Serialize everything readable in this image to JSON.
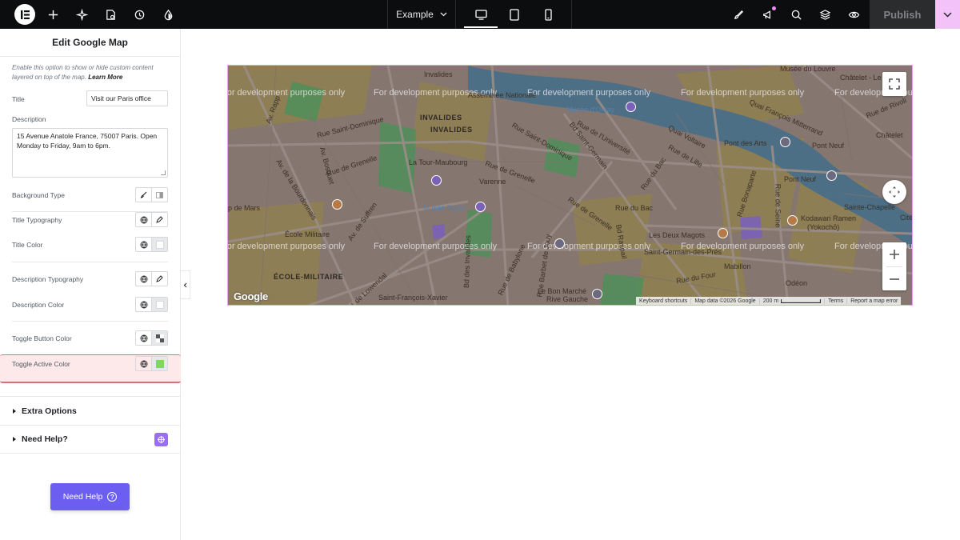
{
  "topbar": {
    "document_name": "Example",
    "publish_label": "Publish"
  },
  "panel": {
    "title": "Edit Google Map",
    "note_text": "Enable this option to show or hide custom content layered on top of the map.",
    "note_link": "Learn More",
    "fields": {
      "title_label": "Title",
      "title_value": "Visit our Paris office",
      "description_label": "Description",
      "description_value": "15 Avenue Anatole France, 75007 Paris. Open Monday to Friday, 9am to 6pm.",
      "background_type_label": "Background Type",
      "title_typography_label": "Title Typography",
      "title_color_label": "Title Color",
      "description_typography_label": "Description Typography",
      "description_color_label": "Description Color",
      "toggle_button_color_label": "Toggle Button Color",
      "toggle_active_color_label": "Toggle Active Color"
    },
    "colors": {
      "toggle_active": "#7ed957",
      "highlight_border": "#e06b7b"
    },
    "sections": {
      "extra_options": "Extra Options",
      "need_help": "Need Help?"
    },
    "help_button": "Need Help"
  },
  "map": {
    "watermark": "For development purposes only",
    "labels": {
      "invalides_1": "INVALIDES",
      "invalides_2": "INVALIDES",
      "invalides_small": "Invalides",
      "ecole_militaire_caps": "ÉCOLE-MILITAIRE",
      "musee_louvre": "Musée du Louvre",
      "chatelet": "Châtelet - Le",
      "chatelet2": "Châtelet",
      "musee_orsay": "Musée d'Orsay",
      "assemblee": "Assemblée Nationale",
      "quai_mitterrand": "Quai François Mitterrand",
      "rue_rivoli": "Rue de Rivoli",
      "pont_arts": "Pont des Arts",
      "pont_neuf_1": "Pont Neuf",
      "pont_neuf_2": "Pont Neuf",
      "quai_voltaire": "Quai Voltaire",
      "rue_universite": "Rue de l'Université",
      "rue_lille": "Rue de Lille",
      "rue_bac": "Rue du Bac",
      "rue_bac_metro": "Rue du Bac",
      "rue_st_dominique": "Rue Saint-Dominique",
      "rue_st_dominique_2": "Rue Saint-Dominique",
      "rue_grenelle_1": "Rue de Grenelle",
      "rue_grenelle_2": "Rue de Grenelle",
      "rue_grenelle_3": "Rue de Grenelle",
      "bd_st_germain": "Bd Saint-Germain",
      "la_tour_maubourg": "La Tour-Maubourg",
      "varenne": "Varenne",
      "musee_rodin": "Musée Rodin",
      "ecole_militaire": "École Militaire",
      "av_rapp": "Av. Rapp",
      "av_bosquet": "Av. Bosquet",
      "av_bourdonnais": "Av. de la Bourdonnais",
      "champ_mars": "p de Mars",
      "les_deux_magots": "Les Deux Magots",
      "st_germain_pres": "Saint-Germain-des-Prés",
      "mabillon": "Mabillon",
      "odeon": "Odéon",
      "rue_four": "Rue du Four",
      "le_bon_marche": "Le Bon Marché",
      "rive_gauche": "Rive Gauche",
      "st_francois_xavier": "Saint-François-Xavier",
      "rue_bonaparte": "Rue Bonaparte",
      "rue_seine": "Rue de Seine",
      "kodawari": "Kodawari Ramen",
      "yokocho": "(Yokochō)",
      "sainte_chapelle": "Sainte-Chapelle",
      "cite": "Cité",
      "bd_raspail": "Bd Raspail",
      "rue_babylone": "Rue de Babylone",
      "bd_invalides": "Bd des Invalides",
      "rue_barbet": "Rue Barbet de Jouy",
      "av_lowendal": "Av. de Lowendal",
      "av_suffren": "Av. de Suffren"
    },
    "attribution": {
      "shortcuts": "Keyboard shortcuts",
      "map_data": "Map data ©2026 Google",
      "scale": "200 m",
      "terms": "Terms",
      "report": "Report a map error"
    },
    "logo": "Google"
  }
}
